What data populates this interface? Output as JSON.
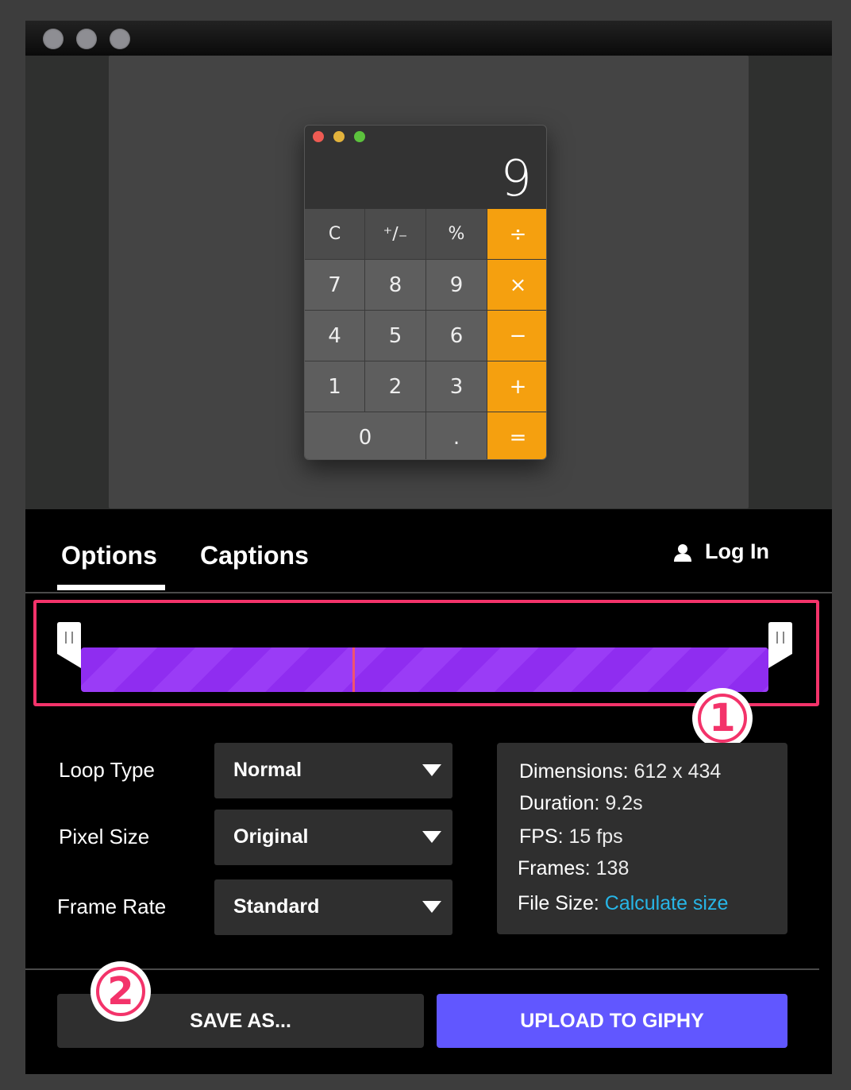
{
  "window": {
    "traffic_lights": [
      "close",
      "minimize",
      "zoom"
    ]
  },
  "preview": {
    "calculator": {
      "display": "9",
      "traffic_light_colors": [
        "#ee5b53",
        "#e3b33c",
        "#5cc23d"
      ],
      "keys": [
        {
          "label": "C",
          "kind": "fn"
        },
        {
          "label": "⁺∕₋",
          "kind": "fn"
        },
        {
          "label": "%",
          "kind": "fn"
        },
        {
          "label": "÷",
          "kind": "op"
        },
        {
          "label": "7",
          "kind": "num"
        },
        {
          "label": "8",
          "kind": "num"
        },
        {
          "label": "9",
          "kind": "num"
        },
        {
          "label": "×",
          "kind": "op"
        },
        {
          "label": "4",
          "kind": "num"
        },
        {
          "label": "5",
          "kind": "num"
        },
        {
          "label": "6",
          "kind": "num"
        },
        {
          "label": "−",
          "kind": "op"
        },
        {
          "label": "1",
          "kind": "num"
        },
        {
          "label": "2",
          "kind": "num"
        },
        {
          "label": "3",
          "kind": "num"
        },
        {
          "label": "+",
          "kind": "op"
        },
        {
          "label": "0",
          "kind": "zero"
        },
        {
          "label": ".",
          "kind": "num"
        },
        {
          "label": "=",
          "kind": "op"
        }
      ]
    }
  },
  "tabs": [
    {
      "label": "Options",
      "active": true
    },
    {
      "label": "Captions",
      "active": false
    }
  ],
  "login": {
    "label": "Log In",
    "icon": "user-icon"
  },
  "timeline": {
    "trim_start": 0.0,
    "trim_end": 1.0,
    "playhead_position": 0.395,
    "track_color": "#8f2df0",
    "highlight_color": "#f3336a"
  },
  "annotations": [
    {
      "number": "1",
      "target": "timeline"
    },
    {
      "number": "2",
      "target": "save-as"
    }
  ],
  "options": [
    {
      "label": "Loop Type",
      "value": "Normal"
    },
    {
      "label": "Pixel Size",
      "value": "Original"
    },
    {
      "label": "Frame Rate",
      "value": "Standard"
    }
  ],
  "info": {
    "dimensions_label": "Dimensions:",
    "dimensions_value": "612 x 434",
    "duration_label": "Duration:",
    "duration_value": "9.2s",
    "fps_label": "FPS:",
    "fps_value": "15 fps",
    "frames_label": "Frames:",
    "frames_value": "138",
    "filesize_label": "File Size:",
    "filesize_link": "Calculate size"
  },
  "actions": {
    "save_label": "SAVE AS...",
    "upload_label": "UPLOAD TO GIPHY",
    "upload_color": "#6157ff"
  }
}
